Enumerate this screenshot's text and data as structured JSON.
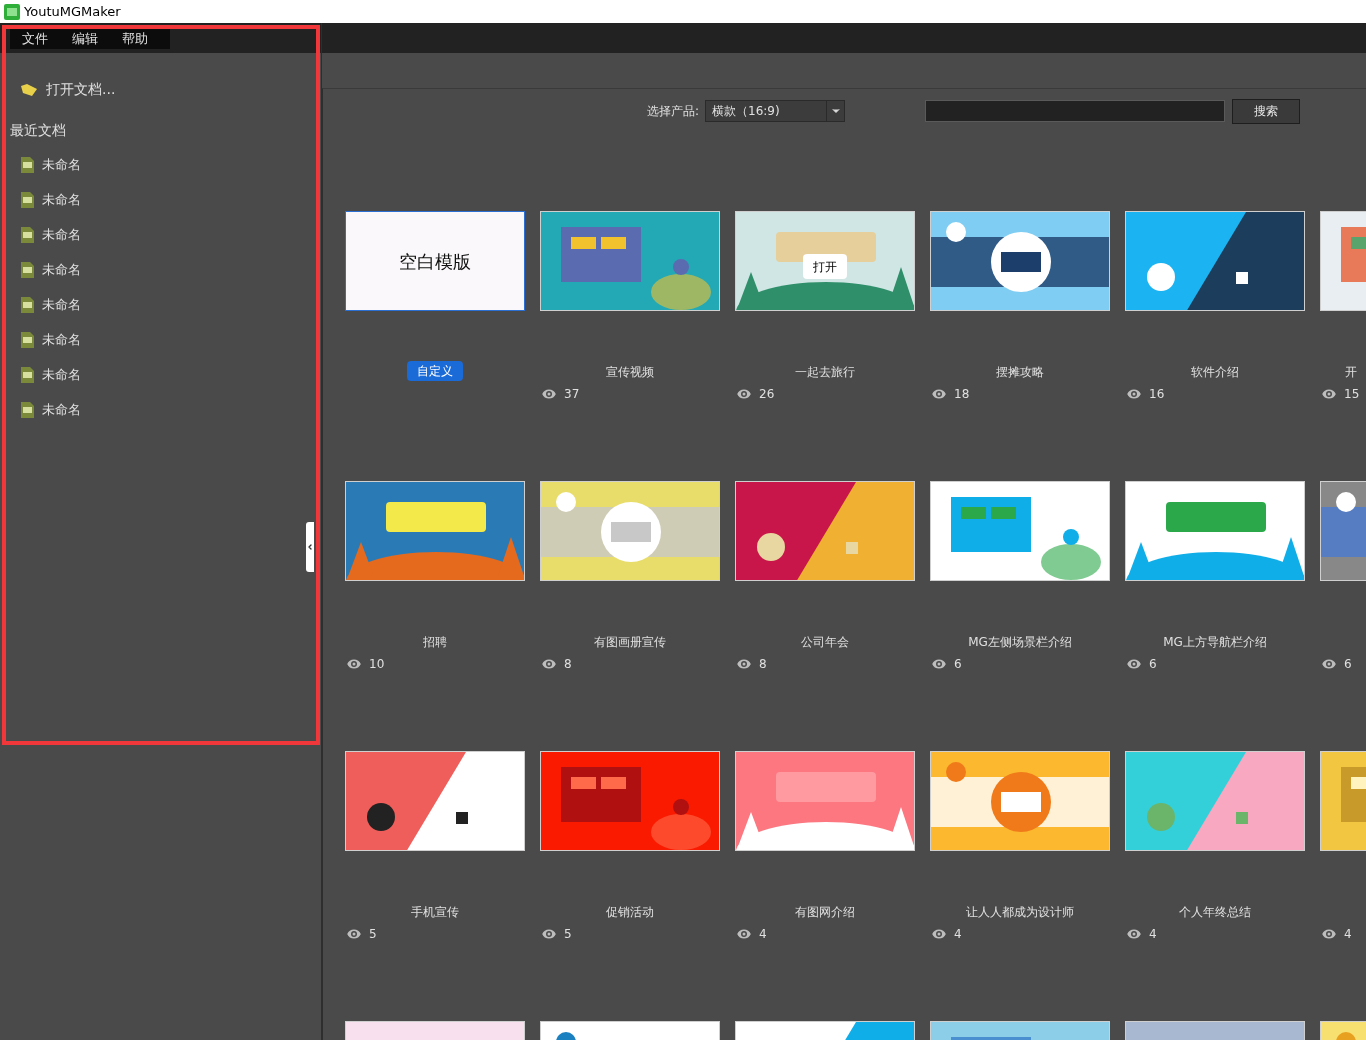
{
  "window": {
    "title": "YoutuMGMaker"
  },
  "menu": [
    {
      "label": "文件"
    },
    {
      "label": "编辑"
    },
    {
      "label": "帮助"
    }
  ],
  "sidebar": {
    "open_label": "打开文档...",
    "recent_heading": "最近文档",
    "recent": [
      "未命名",
      "未命名",
      "未命名",
      "未命名",
      "未命名",
      "未命名",
      "未命名",
      "未命名"
    ]
  },
  "toolbar": {
    "product_label": "选择产品:",
    "product_value": "横款（16:9)",
    "search_button": "搜索"
  },
  "cards": [
    {
      "kind": "blank",
      "label": "空白模版",
      "badge": "自定义"
    },
    {
      "kind": "template",
      "title": "宣传视频",
      "views": "37"
    },
    {
      "kind": "template",
      "title": "一起去旅行",
      "views": "26",
      "hover_button": "打开"
    },
    {
      "kind": "template",
      "title": "摆摊攻略",
      "views": "18"
    },
    {
      "kind": "template",
      "title": "软件介绍",
      "views": "16"
    },
    {
      "kind": "template",
      "title": "开",
      "views": "15"
    },
    {
      "kind": "template",
      "title": "招聘",
      "views": "10"
    },
    {
      "kind": "template",
      "title": "有图画册宣传",
      "views": "8"
    },
    {
      "kind": "template",
      "title": "公司年会",
      "views": "8"
    },
    {
      "kind": "template",
      "title": "MG左侧场景栏介绍",
      "views": "6"
    },
    {
      "kind": "template",
      "title": "MG上方导航栏介绍",
      "views": "6"
    },
    {
      "kind": "template",
      "views": "6"
    },
    {
      "kind": "template",
      "title": "手机宣传",
      "views": "5"
    },
    {
      "kind": "template",
      "title": "促销活动",
      "views": "5"
    },
    {
      "kind": "template",
      "title": "有图网介绍",
      "views": "4"
    },
    {
      "kind": "template",
      "title": "让人人都成为设计师",
      "views": "4"
    },
    {
      "kind": "template",
      "title": "个人年终总结",
      "views": "4"
    },
    {
      "kind": "template",
      "views": "4"
    },
    {
      "kind": "template"
    },
    {
      "kind": "template"
    },
    {
      "kind": "template"
    },
    {
      "kind": "template"
    },
    {
      "kind": "template"
    },
    {
      "kind": "template"
    }
  ]
}
